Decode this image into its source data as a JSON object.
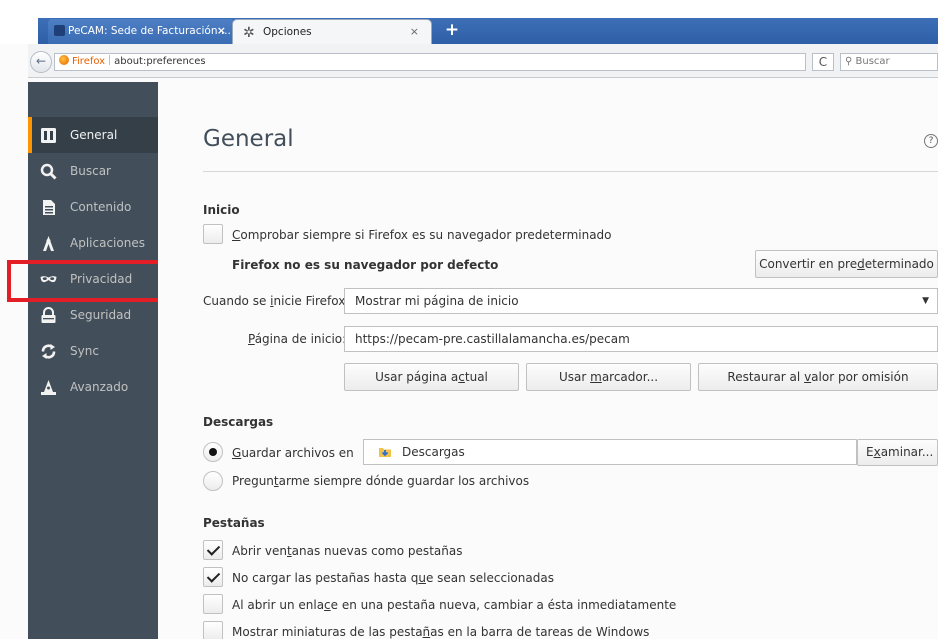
{
  "browser": {
    "tabs": [
      {
        "label": "PeCAM: Sede de Facturación ...",
        "close": "×"
      },
      {
        "label": "Opciones",
        "close": "×"
      }
    ],
    "new_tab": "+",
    "back": "←",
    "identity_label": "Firefox",
    "url": "about:preferences",
    "reload": "C",
    "search_placeholder": "Buscar"
  },
  "sidebar": {
    "items": [
      {
        "label": "General",
        "icon": "general-icon",
        "selected": true
      },
      {
        "label": "Buscar",
        "icon": "search-icon"
      },
      {
        "label": "Contenido",
        "icon": "document-icon"
      },
      {
        "label": "Aplicaciones",
        "icon": "applications-icon"
      },
      {
        "label": "Privacidad",
        "icon": "mask-icon"
      },
      {
        "label": "Seguridad",
        "icon": "lock-icon"
      },
      {
        "label": "Sync",
        "icon": "sync-icon"
      },
      {
        "label": "Avanzado",
        "icon": "wizard-icon"
      }
    ]
  },
  "page": {
    "title": "General",
    "help": "?"
  },
  "startup": {
    "title": "Inicio",
    "default_check": {
      "pre": "",
      "u": "C",
      "post": "omprobar siempre si Firefox es su navegador predeterminado",
      "checked": false
    },
    "not_default_text": "Firefox no es su navegador por defecto",
    "make_default_btn": {
      "pre": "Convertir en pre",
      "u": "d",
      "post": "eterminado"
    },
    "when_starts": {
      "pre": "Cuando se ",
      "u": "i",
      "post": "nicie Firefox:"
    },
    "when_starts_value": "Mostrar mi página de inicio",
    "homepage_label": {
      "pre": "",
      "u": "P",
      "post": "ágina de inicio:"
    },
    "homepage_value": "https://pecam-pre.castillalamancha.es/pecam",
    "use_current_btn": {
      "pre": "Usar página a",
      "u": "c",
      "post": "tual"
    },
    "use_bookmark_btn": {
      "pre": "Usar ",
      "u": "m",
      "post": "arcador..."
    },
    "restore_default_btn": {
      "pre": "Restaurar al ",
      "u": "v",
      "post": "alor por omisión"
    }
  },
  "downloads": {
    "title": "Descargas",
    "save_to": {
      "pre": "",
      "u": "G",
      "post": "uardar archivos en",
      "checked": true
    },
    "folder": "Descargas",
    "browse_btn": {
      "pre": "E",
      "u": "x",
      "post": "aminar..."
    },
    "always_ask": {
      "pre": "Pregun",
      "u": "t",
      "post": "arme siempre dónde guardar los archivos",
      "checked": false
    }
  },
  "tabs_section": {
    "title": "Pestañas",
    "items": [
      {
        "pre": "Abrir ven",
        "u": "t",
        "post": "anas nuevas como pestañas",
        "checked": true
      },
      {
        "pre": "No cargar las pestañas hasta q",
        "u": "u",
        "post": "e sean seleccionadas",
        "checked": true
      },
      {
        "pre": "Al abrir un enla",
        "u": "c",
        "post": "e en una pestaña nueva, cambiar a ésta inmediatamente",
        "checked": false
      },
      {
        "pre": "Mostrar miniaturas de las pesta",
        "u": "ñ",
        "post": "as en la barra de tareas de Windows",
        "checked": false
      }
    ]
  },
  "colors": {
    "sidebar_bg": "#424f5a",
    "selected_accent": "#ff9500",
    "highlight": "#e41e26",
    "tabbar": "#3c6fb7"
  }
}
